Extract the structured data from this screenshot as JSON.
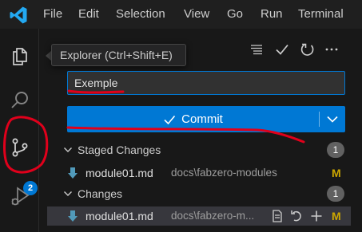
{
  "menu": {
    "items": [
      "File",
      "Edit",
      "Selection",
      "View",
      "Go",
      "Run",
      "Terminal"
    ]
  },
  "activity_bar": {
    "icons": [
      "explorer-icon",
      "search-icon",
      "source-control-icon",
      "run-debug-icon"
    ],
    "source_control_badge": "2"
  },
  "tooltip": {
    "text": "Explorer (Ctrl+Shift+E)"
  },
  "scm": {
    "toolbar_icons": [
      "view-as-list-icon",
      "check-icon",
      "refresh-icon",
      "more-actions-icon"
    ],
    "message_value": "Exemple",
    "commit_label": "Commit",
    "staged": {
      "title": "Staged Changes",
      "count": "1",
      "files": [
        {
          "name": "module01.md",
          "path": "docs\\fabzero-modules",
          "status": "M"
        }
      ]
    },
    "changes": {
      "title": "Changes",
      "count": "1",
      "files": [
        {
          "name": "module01.md",
          "path": "docs\\fabzero-m...",
          "status": "M"
        }
      ]
    }
  },
  "colors": {
    "accent": "#0078d4",
    "annotation": "#e0001b",
    "modified": "#cca700"
  }
}
